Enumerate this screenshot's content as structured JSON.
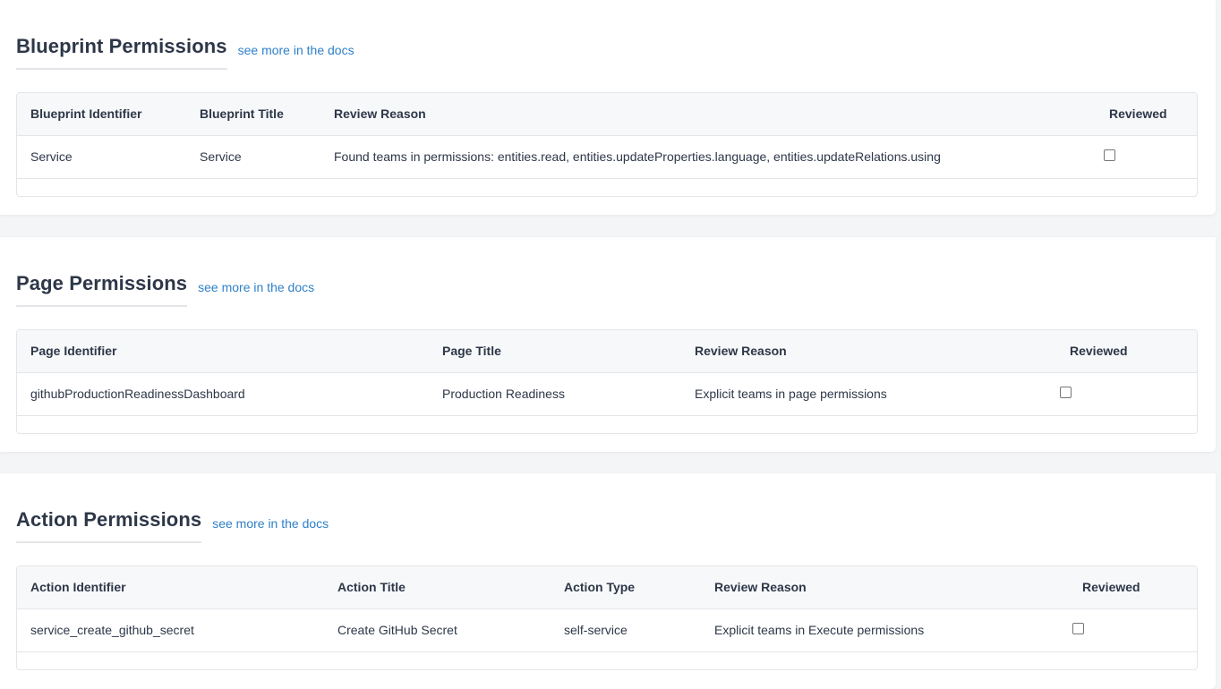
{
  "blueprint": {
    "title": "Blueprint Permissions",
    "docs_link": "see more in the docs",
    "columns": [
      "Blueprint Identifier",
      "Blueprint Title",
      "Review Reason",
      "Reviewed"
    ],
    "rows": [
      {
        "identifier": "Service",
        "title": "Service",
        "reason": "Found teams in permissions: entities.read, entities.updateProperties.language, entities.updateRelations.using",
        "reviewed": false
      }
    ]
  },
  "page": {
    "title": "Page Permissions",
    "docs_link": "see more in the docs",
    "columns": [
      "Page Identifier",
      "Page Title",
      "Review Reason",
      "Reviewed"
    ],
    "rows": [
      {
        "identifier": "githubProductionReadinessDashboard",
        "title": "Production Readiness",
        "reason": "Explicit teams in page permissions",
        "reviewed": false
      }
    ]
  },
  "action": {
    "title": "Action Permissions",
    "docs_link": "see more in the docs",
    "columns": [
      "Action Identifier",
      "Action Title",
      "Action Type",
      "Review Reason",
      "Reviewed"
    ],
    "rows": [
      {
        "identifier": "service_create_github_secret",
        "title": "Create GitHub Secret",
        "type": "self-service",
        "reason": "Explicit teams in Execute permissions",
        "reviewed": false
      }
    ]
  },
  "colors": {
    "link": "#2f80c8",
    "heading": "#2d3748",
    "border": "#e3e5e8",
    "header_bg": "#f7f8fa"
  }
}
